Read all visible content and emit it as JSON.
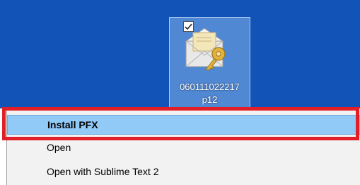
{
  "desktop": {
    "background": "#1153b6",
    "file": {
      "icon": "certificate-envelope-key-icon",
      "checked": true,
      "label_line1": "060111022217",
      "label_line2": "p12"
    }
  },
  "context_menu": {
    "items": [
      {
        "label": "Install PFX",
        "highlighted": true
      },
      {
        "label": "Open",
        "highlighted": false
      },
      {
        "label": "Open with Sublime Text 2",
        "highlighted": false
      }
    ]
  },
  "highlight_color": "#e21f26"
}
